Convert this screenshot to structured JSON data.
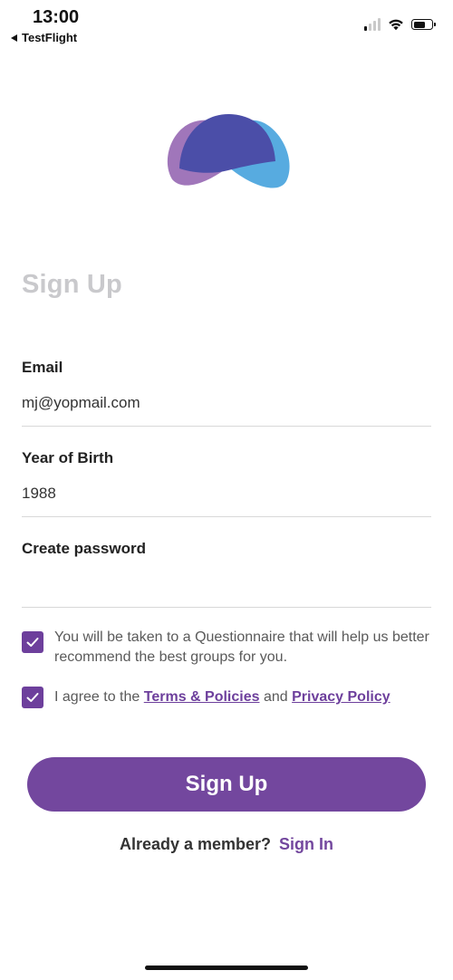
{
  "status_bar": {
    "time": "13:00",
    "back_label": "TestFlight",
    "battery_level_percent": 60
  },
  "logo": {
    "icon": "brand-logo-icon",
    "colors": {
      "left": "#9b6fb6",
      "right": "#4ea7de",
      "center": "#4b4ea8"
    }
  },
  "title": "Sign Up",
  "form": {
    "email": {
      "label": "Email",
      "value": "mj@yopmail.com"
    },
    "year_of_birth": {
      "label": "Year of Birth",
      "value": "1988"
    },
    "password": {
      "label": "Create password",
      "value": ""
    }
  },
  "checkboxes": {
    "questionnaire": {
      "checked": true,
      "text": "You will be taken to a Questionnaire that will help us better recommend the best groups for you."
    },
    "terms": {
      "checked": true,
      "prefix": "I agree to the",
      "terms_link": "Terms & Policies",
      "conjunction": "and",
      "privacy_link": "Privacy Policy"
    }
  },
  "buttons": {
    "sign_up": "Sign Up"
  },
  "footer": {
    "prompt": "Already a member?",
    "sign_in_link": "Sign In"
  },
  "colors": {
    "accent": "#73479e",
    "title_gray": "#c9c9cc",
    "divider": "#d8d8d8"
  }
}
